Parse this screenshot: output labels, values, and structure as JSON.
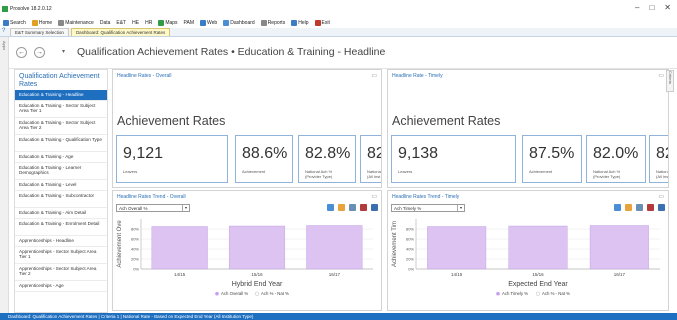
{
  "window": {
    "title": "Prosolve 18.2.0.12",
    "controls": [
      "–",
      "□",
      "✕"
    ]
  },
  "menu": [
    {
      "label": "Search",
      "icon": "search-icon",
      "color": "#3b7cc7"
    },
    {
      "label": "Home",
      "icon": "home-icon",
      "color": "#e3a020"
    },
    {
      "label": "Maintenance",
      "icon": "wrench-icon",
      "color": "#888888"
    },
    {
      "label": "Data",
      "icon": "",
      "color": ""
    },
    {
      "label": "E&T",
      "icon": "",
      "color": ""
    },
    {
      "label": "HE",
      "icon": "",
      "color": ""
    },
    {
      "label": "HR",
      "icon": "",
      "color": ""
    },
    {
      "label": "Maps",
      "icon": "globe-icon",
      "color": "#2e9d46"
    },
    {
      "label": "PAM",
      "icon": "",
      "color": ""
    },
    {
      "label": "Web",
      "icon": "web-icon",
      "color": "#3b7cc7"
    },
    {
      "label": "Dashboard",
      "icon": "dashboard-icon",
      "color": "#4a8fd6"
    },
    {
      "label": "Reports",
      "icon": "report-icon",
      "color": "#888888"
    },
    {
      "label": "Help",
      "icon": "help-icon",
      "color": "#3b7cc7"
    },
    {
      "label": "Exit",
      "icon": "exit-icon",
      "color": "#c0392b"
    }
  ],
  "doc_tabs": [
    {
      "label": "E&T Summary Selection",
      "active": false
    },
    {
      "label": "Dashboard: Qualification Achievement Rates",
      "active": true
    }
  ],
  "help_mark": "?",
  "left_rail": "Apps",
  "header": {
    "back": "←",
    "forward": "→",
    "dropdown_arrow": "▾",
    "breadcrumb": "Qualification Achievement Rates  •  Education & Training - Headline"
  },
  "sidebar": {
    "title": "Qualification Achievement Rates",
    "items": [
      {
        "label": "Education & Training - Headline",
        "active": true,
        "tall": false
      },
      {
        "label": "Education & Training - Sector Subject Area Tier 1",
        "active": false,
        "tall": true
      },
      {
        "label": "Education & Training - Sector Subject Area Tier 2",
        "active": false,
        "tall": true
      },
      {
        "label": "Education & Training - Qualification Type",
        "active": false,
        "tall": true
      },
      {
        "label": "Education & Training - Age",
        "active": false,
        "tall": false
      },
      {
        "label": "Education & Training - Learner Demographics",
        "active": false,
        "tall": true
      },
      {
        "label": "Education & Training - Level",
        "active": false,
        "tall": false
      },
      {
        "label": "Education & Training - Subcontractor",
        "active": false,
        "tall": true
      },
      {
        "label": "Education & Training - Aim Detail",
        "active": false,
        "tall": false
      },
      {
        "label": "Education & Training - Enrolment Detail",
        "active": false,
        "tall": true
      },
      {
        "label": "Apprenticeships - Headline",
        "active": false,
        "tall": false
      },
      {
        "label": "Apprenticeships - Sector Subject Area Tier 1",
        "active": false,
        "tall": true
      },
      {
        "label": "Apprenticeships - Sector Subject Area Tier 2",
        "active": false,
        "tall": true
      },
      {
        "label": "Apprenticeships - Age",
        "active": false,
        "tall": false
      }
    ]
  },
  "panels": {
    "overall": {
      "title": "Headline Rates - Overall",
      "heading": "Achievement Rates",
      "kpis": [
        {
          "value": "9,121",
          "label": "Leavers"
        },
        {
          "value": "88.6%",
          "label": "Achievement"
        },
        {
          "value": "82.8%",
          "label": "National Ach %\n(Provider Type)"
        },
        {
          "value": "82.",
          "label": "Nationa\n(All Inst"
        }
      ]
    },
    "timely": {
      "title": "Headline Rate - Timely",
      "heading": "Achievement Rates",
      "kpis": [
        {
          "value": "9,138",
          "label": "Leavers"
        },
        {
          "value": "87.5%",
          "label": "Achievement"
        },
        {
          "value": "82.0%",
          "label": "National Ach %\n(Provider Type)"
        },
        {
          "value": "82.(",
          "label": "National\n(All Instit"
        }
      ]
    },
    "trend_overall": {
      "title": "Headline Rates Trend - Overall",
      "select": "Ach Overall %",
      "ylabel": "Achievement Ove",
      "xlabel": "Hybrid End Year",
      "legend": [
        "Ach Overall %",
        "Ach % - Nat %"
      ]
    },
    "trend_timely": {
      "title": "Headline Rates Trend - Timely",
      "select": "Ach Timely %",
      "ylabel": "Achievement Tim",
      "xlabel": "Expected End Year",
      "legend": [
        "Ach Timely %",
        "Ach % - Nat %"
      ]
    }
  },
  "right_tab": "Criteria",
  "status": "Dashboard: Qualification Achievement Rates  |  Criteria  1  |  National Rate - Based on Expected End Year (All Institution Type)",
  "colors": {
    "accent": "#1f6fc1",
    "bar": "#dcc3f2",
    "bar_stroke": "#b99ae0",
    "legend_marker": "#c79ff0"
  },
  "chart_data": [
    {
      "type": "bar",
      "categories": [
        "14/15",
        "15/16",
        "16/17"
      ],
      "series": [
        {
          "name": "Ach Overall %",
          "values": [
            85,
            86,
            87
          ]
        }
      ],
      "xlabel": "Hybrid End Year",
      "ylabel": "Achievement Ove",
      "ylim": [
        0,
        100
      ],
      "yticks": [
        "0%",
        "20%",
        "40%",
        "60%",
        "80%"
      ],
      "legend_position": "bottom",
      "grid": true
    },
    {
      "type": "bar",
      "categories": [
        "14/15",
        "15/16",
        "16/17"
      ],
      "series": [
        {
          "name": "Ach Timely %",
          "values": [
            85,
            86,
            87
          ]
        }
      ],
      "xlabel": "Expected End Year",
      "ylabel": "Achievement Tim",
      "ylim": [
        0,
        100
      ],
      "yticks": [
        "0%",
        "20%",
        "40%",
        "60%",
        "80%"
      ],
      "legend_position": "bottom",
      "grid": true
    }
  ]
}
